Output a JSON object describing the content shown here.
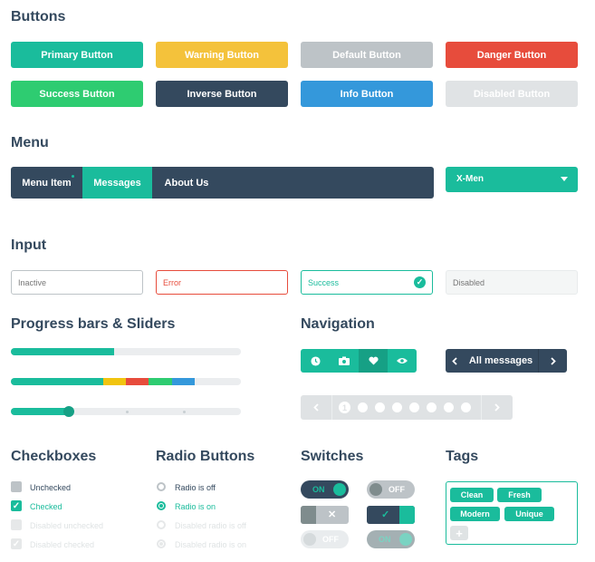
{
  "sections": {
    "buttons": "Buttons",
    "menu": "Menu",
    "input": "Input",
    "progress": "Progress bars & Sliders",
    "navigation": "Navigation",
    "checkboxes": "Checkboxes",
    "radio": "Radio Buttons",
    "switches": "Switches",
    "tags": "Tags"
  },
  "buttons": {
    "primary": "Primary Button",
    "warning": "Warning Button",
    "default": "Default Button",
    "danger": "Danger Button",
    "success": "Success Button",
    "inverse": "Inverse Button",
    "info": "Info Button",
    "disabled": "Disabled Button"
  },
  "menu": {
    "items": [
      "Menu Item",
      "Messages",
      "About Us"
    ],
    "active_index": 1,
    "select_value": "X-Men"
  },
  "inputs": {
    "inactive_placeholder": "Inactive",
    "error_value": "Error",
    "success_value": "Success",
    "disabled_placeholder": "Disabled"
  },
  "progress": {
    "bar1": 0.45,
    "bar2_segments": [
      {
        "color": "#1abc9c",
        "fraction": 0.4
      },
      {
        "color": "#f1c40f",
        "fraction": 0.1
      },
      {
        "color": "#e74c3c",
        "fraction": 0.1
      },
      {
        "color": "#2ecc71",
        "fraction": 0.1
      },
      {
        "color": "#3498db",
        "fraction": 0.1
      }
    ],
    "slider_value": 0.25
  },
  "navigation": {
    "icon_group": [
      "clock-icon",
      "camera-icon",
      "heart-icon",
      "eye-icon"
    ],
    "active_icon_index": 2,
    "messages_label": "All messages",
    "pager_current": "1",
    "pager_dots": 7
  },
  "checkboxes": {
    "unchecked": "Unchecked",
    "checked": "Checked",
    "disabled_unchecked": "Disabled unchecked",
    "disabled_checked": "Disabled checked"
  },
  "radio": {
    "off": "Radio is off",
    "on": "Radio is on",
    "disabled_off": "Disabled radio is off",
    "disabled_on": "Disabled radio is on"
  },
  "switches": {
    "on_label": "ON",
    "off_label": "OFF",
    "cross": "✕",
    "check": "✓"
  },
  "tags": [
    "Clean",
    "Fresh",
    "Modern",
    "Unique"
  ],
  "colors": {
    "turquoise": "#1abc9c",
    "yellow": "#f4c23b",
    "gray": "#bdc3c7",
    "red": "#e74c3c",
    "green": "#2ecc71",
    "navy": "#34495e",
    "blue": "#3498db",
    "light": "#d8dde0"
  }
}
